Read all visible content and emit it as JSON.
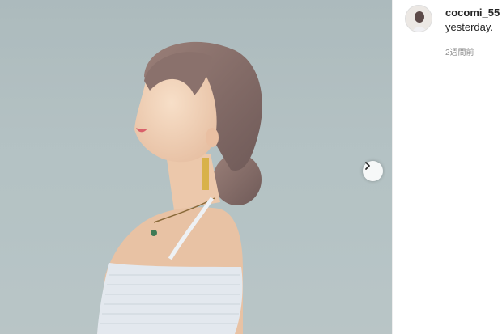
{
  "post": {
    "username": "cocomi_55",
    "caption": "yesterday.",
    "timestamp": "2週間前"
  },
  "media": {
    "next_icon": "chevron-right-icon",
    "accent": "#8e8e8e"
  }
}
